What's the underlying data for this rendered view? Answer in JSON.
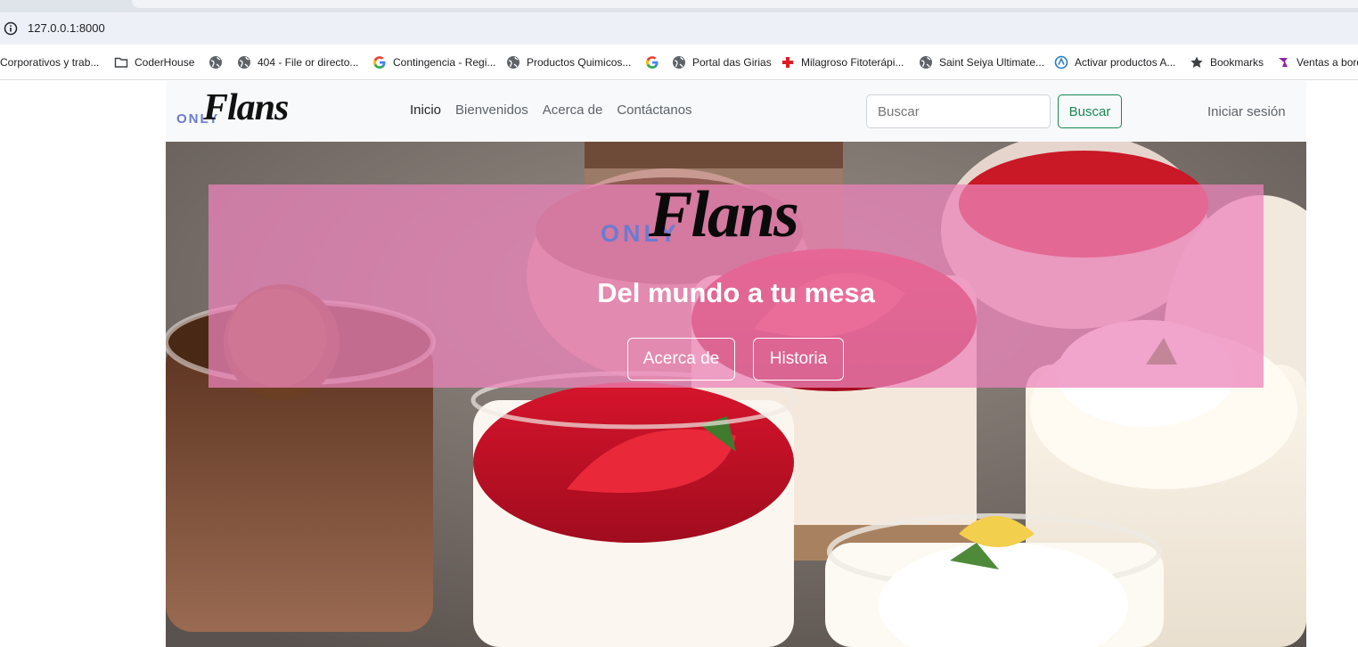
{
  "browser": {
    "url": "127.0.0.1:8000",
    "bookmarks": [
      {
        "label": "Corporativos y trab...",
        "icon": "none"
      },
      {
        "label": "CoderHouse",
        "icon": "folder-icon"
      },
      {
        "label": "",
        "icon": "globe-icon"
      },
      {
        "label": "404 - File or directo...",
        "icon": "globe-icon"
      },
      {
        "label": "Contingencia - Regi...",
        "icon": "google-icon"
      },
      {
        "label": "Productos Quimicos...",
        "icon": "globe-icon"
      },
      {
        "label": "",
        "icon": "google-icon"
      },
      {
        "label": "Portal das Girias",
        "icon": "globe-icon"
      },
      {
        "label": "Milagroso Fitoterápi...",
        "icon": "red-cross-icon"
      },
      {
        "label": "Saint Seiya Ultimate...",
        "icon": "globe-icon"
      },
      {
        "label": "Activar productos A...",
        "icon": "activation-icon"
      },
      {
        "label": "Bookmarks",
        "icon": "star-icon"
      },
      {
        "label": "Ventas a bord",
        "icon": "purple-logo-icon"
      }
    ]
  },
  "site": {
    "logo": {
      "only": "ONLY",
      "flans": "Flans"
    },
    "nav": {
      "links": [
        "Inicio",
        "Bienvenidos",
        "Acerca de",
        "Contáctanos"
      ],
      "search_placeholder": "Buscar",
      "search_button": "Buscar",
      "login": "Iniciar sesión"
    },
    "hero": {
      "logo_only": "ONLY",
      "logo_flans": "Flans",
      "tagline": "Del mundo a tu mesa",
      "buttons": [
        "Acerca de",
        "Historia"
      ]
    }
  },
  "colors": {
    "accent_green": "#198754",
    "logo_blue": "#6b7bd0",
    "hero_overlay_pink": "#ec84ba"
  }
}
